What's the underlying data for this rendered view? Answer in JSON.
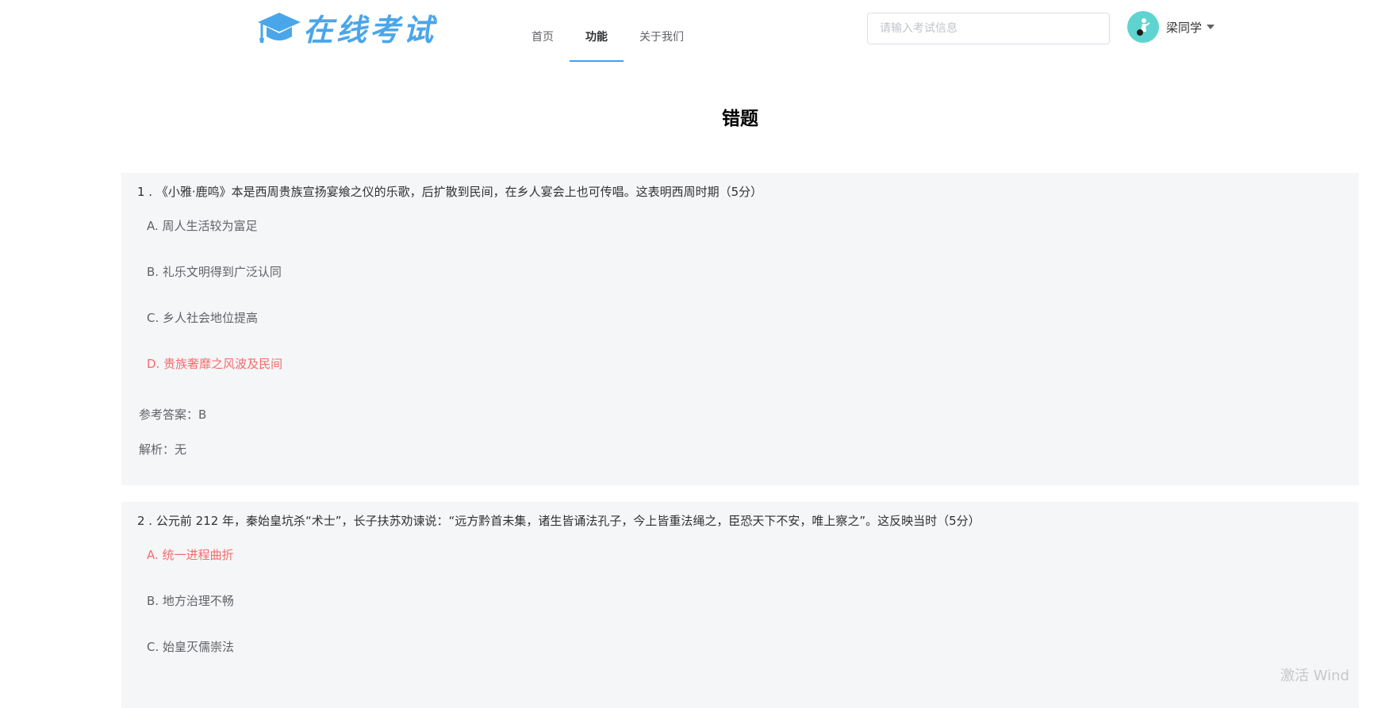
{
  "header": {
    "logo_text": "在线考试",
    "nav": [
      {
        "label": "首页"
      },
      {
        "label": "功能"
      },
      {
        "label": "关于我们"
      }
    ],
    "active_nav": "功能",
    "search": {
      "placeholder": "请输入考试信息",
      "value": ""
    },
    "user": {
      "name": "梁同学"
    }
  },
  "page": {
    "title": "错题"
  },
  "questions": [
    {
      "stem": "1 . 《小雅·鹿鸣》本是西周贵族宣扬宴飨之仪的乐歌，后扩散到民间，在乡人宴会上也可传唱。这表明西周时期（5分）",
      "options": [
        {
          "text": "A. 周人生活较为富足",
          "state": "normal"
        },
        {
          "text": "B. 礼乐文明得到广泛认同",
          "state": "normal"
        },
        {
          "text": "C. 乡人社会地位提高",
          "state": "normal"
        },
        {
          "text": "D. 贵族奢靡之风波及民间",
          "state": "wrong"
        }
      ],
      "answer": "参考答案：B",
      "analysis": "解析：无"
    },
    {
      "stem": "2 . 公元前 212 年，秦始皇坑杀“术士”，长子扶苏劝谏说：“远方黔首未集，诸生皆诵法孔子，今上皆重法绳之，臣恐天下不安，唯上察之”。这反映当时（5分）",
      "options": [
        {
          "text": "A. 统一进程曲折",
          "state": "wrong"
        },
        {
          "text": "B. 地方治理不畅",
          "state": "normal"
        },
        {
          "text": "C. 始皇灭儒崇法",
          "state": "normal"
        }
      ]
    }
  ],
  "watermark": "激活 Wind",
  "colors": {
    "accent": "#409eff",
    "logo": "#4aa6ea",
    "wrong_option": "#f56c6c",
    "question_bg": "#f5f6f8",
    "avatar_bg": "#5fd3cf"
  },
  "icons": {
    "logo": "graduation-cap-icon",
    "avatar": "user-avatar-icon",
    "dropdown": "caret-down-icon"
  }
}
